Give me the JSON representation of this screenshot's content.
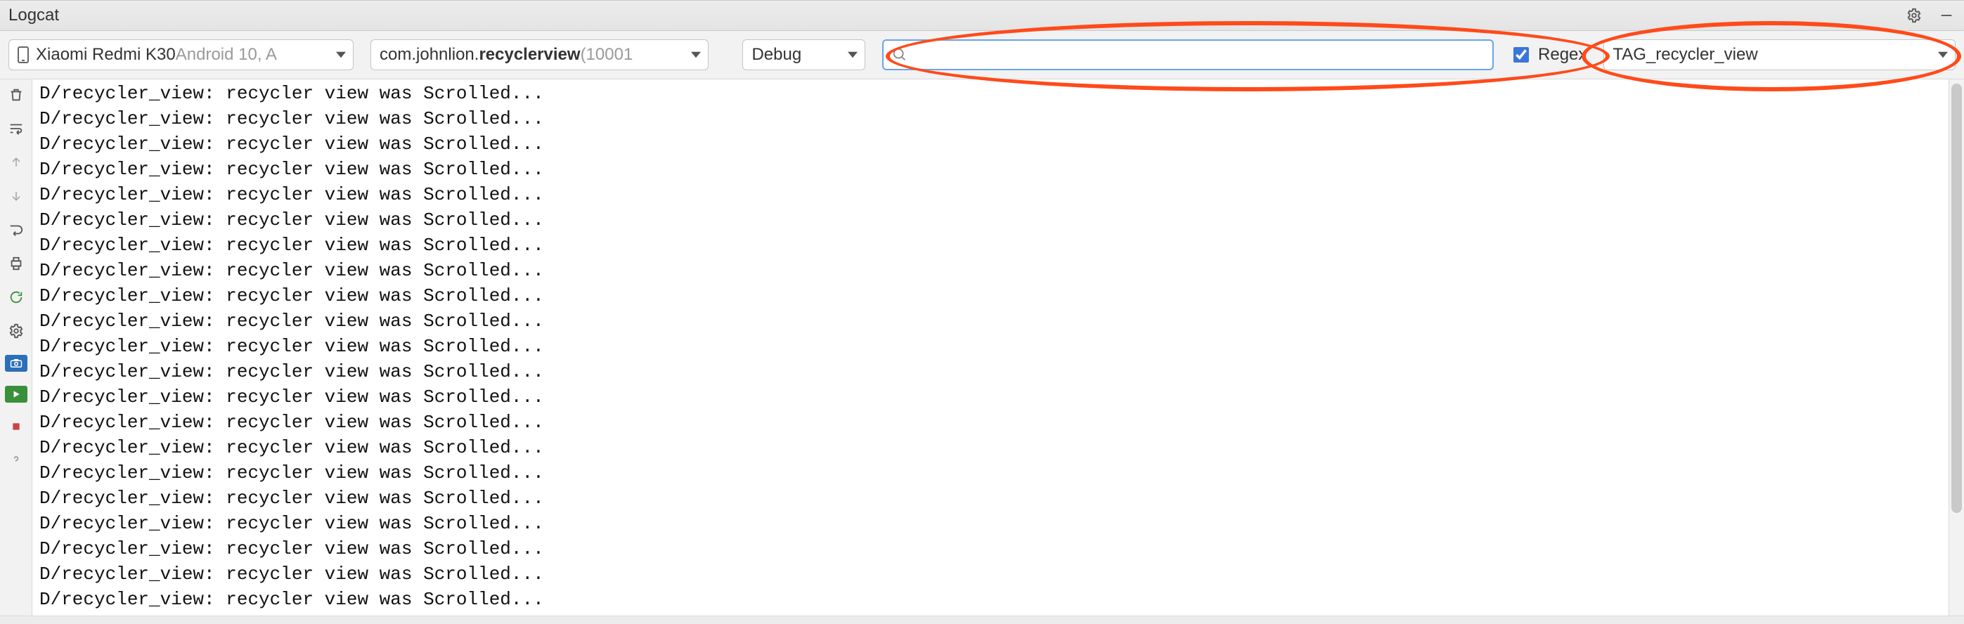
{
  "titlebar": {
    "label": "Logcat"
  },
  "toolbar": {
    "device": {
      "name": "Xiaomi Redmi K30 ",
      "os": "Android 10, A"
    },
    "process": {
      "pkg_prefix": "com.johnlion.",
      "pkg_bold": "recyclerview",
      "pid": " (10001"
    },
    "level": {
      "value": "Debug"
    },
    "search": {
      "value": "",
      "placeholder": ""
    },
    "regex": {
      "checked": true,
      "label": "Regex"
    },
    "filter": {
      "value": "TAG_recycler_view"
    }
  },
  "gutter": {
    "items": [
      "trash-icon",
      "soft-wrap-icon",
      "arrow-up-icon",
      "arrow-down-icon",
      "restart-icon",
      "print-icon",
      "rerun-icon",
      "gear-icon",
      "screenshot-icon",
      "screen-record-icon",
      "stop-icon",
      "help-icon"
    ]
  },
  "log": {
    "lines": [
      "D/recycler_view: recycler view was Scrolled...",
      "D/recycler_view: recycler view was Scrolled...",
      "D/recycler_view: recycler view was Scrolled...",
      "D/recycler_view: recycler view was Scrolled...",
      "D/recycler_view: recycler view was Scrolled...",
      "D/recycler_view: recycler view was Scrolled...",
      "D/recycler_view: recycler view was Scrolled...",
      "D/recycler_view: recycler view was Scrolled...",
      "D/recycler_view: recycler view was Scrolled...",
      "D/recycler_view: recycler view was Scrolled...",
      "D/recycler_view: recycler view was Scrolled...",
      "D/recycler_view: recycler view was Scrolled...",
      "D/recycler_view: recycler view was Scrolled...",
      "D/recycler_view: recycler view was Scrolled...",
      "D/recycler_view: recycler view was Scrolled...",
      "D/recycler_view: recycler view was Scrolled...",
      "D/recycler_view: recycler view was Scrolled...",
      "D/recycler_view: recycler view was Scrolled...",
      "D/recycler_view: recycler view was Scrolled...",
      "D/recycler_view: recycler view was Scrolled...",
      "D/recycler_view: recycler view was Scrolled..."
    ]
  }
}
